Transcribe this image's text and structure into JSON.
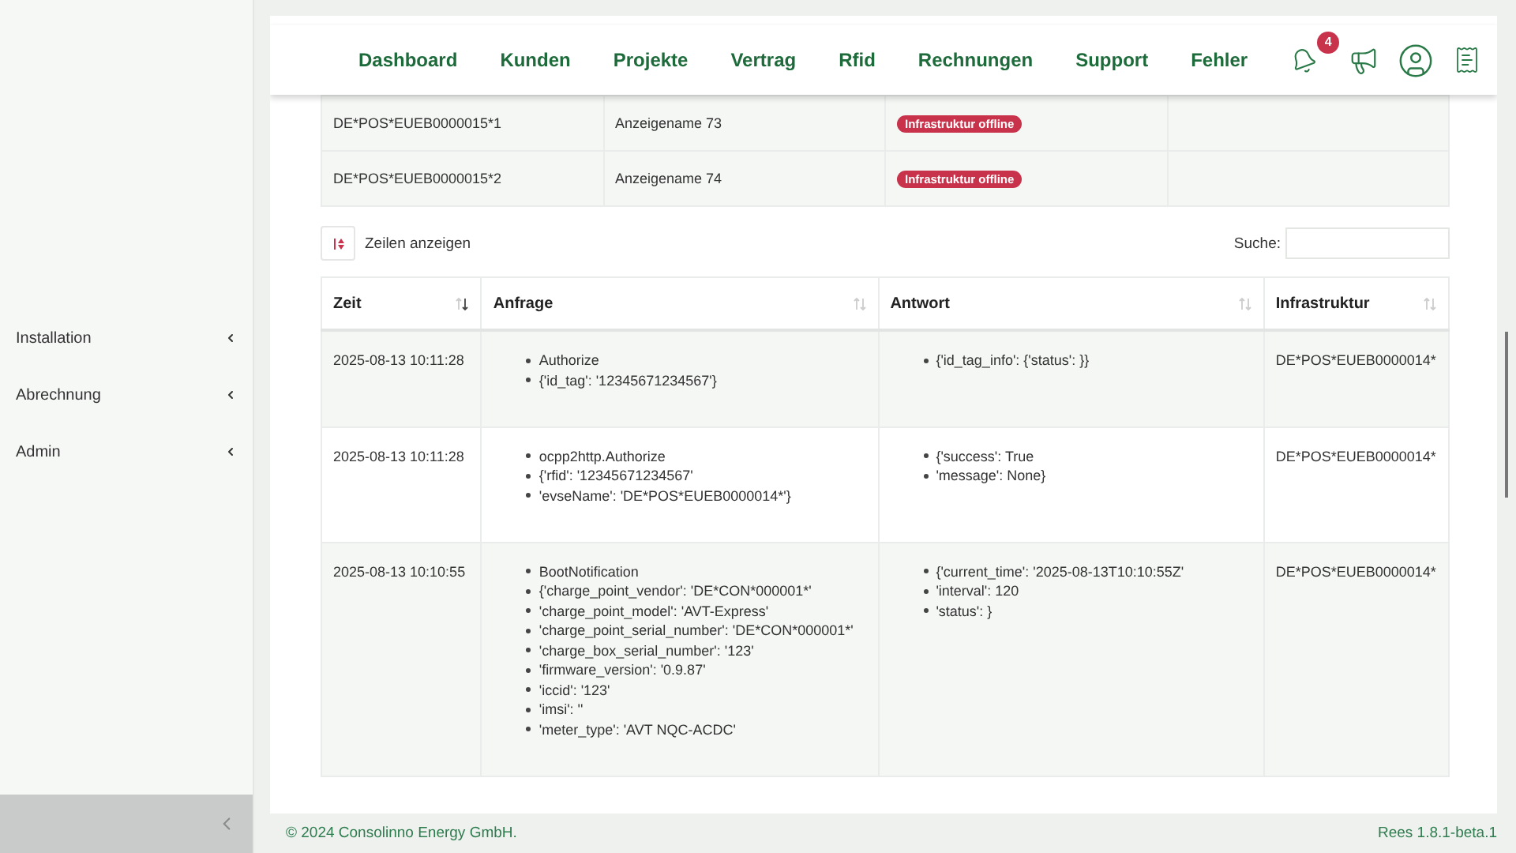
{
  "sidebar": {
    "items": [
      {
        "label": "Installation",
        "expanded": false
      },
      {
        "label": "Abrechnung",
        "expanded": false
      },
      {
        "label": "Admin",
        "expanded": false
      }
    ]
  },
  "nav": {
    "links": [
      "Dashboard",
      "Kunden",
      "Projekte",
      "Vertrag",
      "Rfid",
      "Rechnungen",
      "Support",
      "Fehler"
    ],
    "notifications": "4"
  },
  "infra_table": {
    "rows": [
      {
        "id": "DE*POS*EUEB0000015*1",
        "name": "Anzeigename 73",
        "status": {
          "label": "Infrastruktur offline",
          "kind": "offline"
        }
      },
      {
        "id": "DE*POS*EUEB0000015*2",
        "name": "Anzeigename 74",
        "status": {
          "label": "Infrastruktur offline",
          "kind": "offline"
        }
      }
    ]
  },
  "length_button": "Zeilen anzeigen",
  "search": {
    "label": "Suche:"
  },
  "log_table": {
    "columns": [
      {
        "label": "Zeit",
        "sorted": true
      },
      {
        "label": "Anfrage",
        "sorted": false
      },
      {
        "label": "Antwort",
        "sorted": false
      },
      {
        "label": "Infrastruktur",
        "sorted": false
      }
    ],
    "rows": [
      {
        "time": "2025-08-13 10:11:28",
        "request": [
          "Authorize",
          "{'id_tag': '12345671234567'}"
        ],
        "response": [
          "{'id_tag_info': {'status': }}"
        ],
        "infrastructure": "DE*POS*EUEB0000014*"
      },
      {
        "time": "2025-08-13 10:11:28",
        "request": [
          "ocpp2http.Authorize",
          "{'rfid': '12345671234567'",
          "'evseName': 'DE*POS*EUEB0000014*'}"
        ],
        "response": [
          "{'success': True",
          "'message': None}"
        ],
        "infrastructure": "DE*POS*EUEB0000014*"
      },
      {
        "time": "2025-08-13 10:10:55",
        "request": [
          "BootNotification",
          "{'charge_point_vendor': 'DE*CON*000001*'",
          "'charge_point_model': 'AVT-Express'",
          "'charge_point_serial_number': 'DE*CON*000001*'",
          "'charge_box_serial_number': '123'",
          "'firmware_version': '0.9.87'",
          "'iccid': '123'",
          "'imsi': ''",
          "'meter_type': 'AVT NQC-ACDC'"
        ],
        "response": [
          "{'current_time': '2025-08-13T10:10:55Z'",
          "'interval': 120",
          "'status': }"
        ],
        "infrastructure": "DE*POS*EUEB0000014*"
      }
    ]
  },
  "footer": {
    "copyright": "© 2024 Consolinno Energy GmbH.",
    "version": "Rees 1.8.1-beta.1"
  }
}
